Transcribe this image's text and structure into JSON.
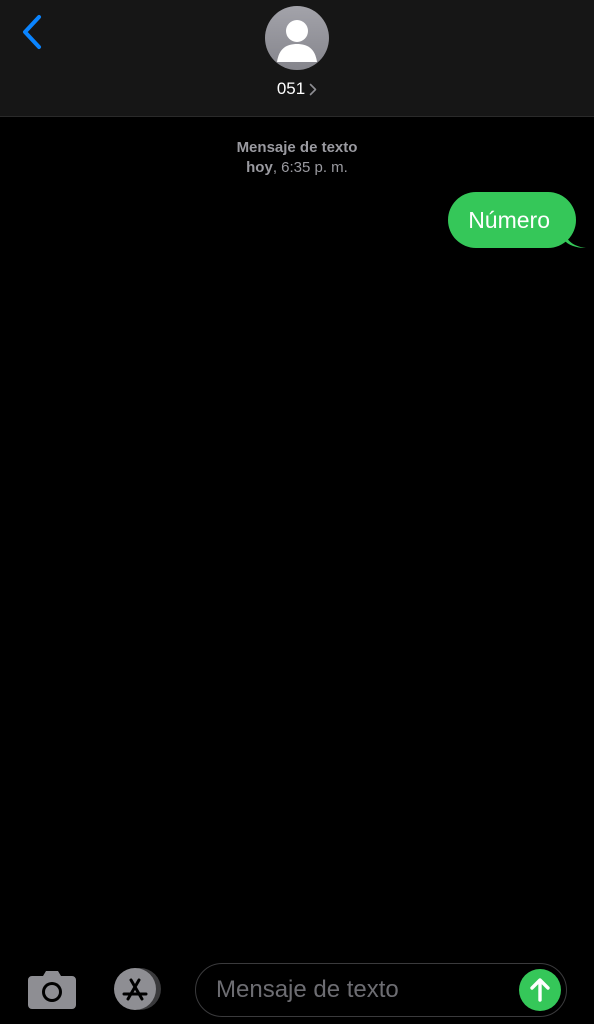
{
  "header": {
    "contact_name": "051",
    "back_icon": "chevron-left-icon",
    "avatar_icon": "person-silhouette-icon",
    "disclosure_icon": "chevron-right-icon"
  },
  "thread": {
    "service_label": "Mensaje de texto",
    "day": "hoy",
    "time": ", 6:35 p. m.",
    "messages": [
      {
        "direction": "outgoing",
        "text": "Número"
      }
    ]
  },
  "composer": {
    "placeholder": "Mensaje de texto",
    "camera_icon": "camera-icon",
    "apps_icon": "app-store-icon",
    "send_icon": "send-arrow-up-icon"
  },
  "colors": {
    "accent_blue": "#0a84ff",
    "bubble_green": "#35c759",
    "header_bg": "#161616",
    "background": "#000000",
    "secondary_text": "#9a9aa0"
  }
}
